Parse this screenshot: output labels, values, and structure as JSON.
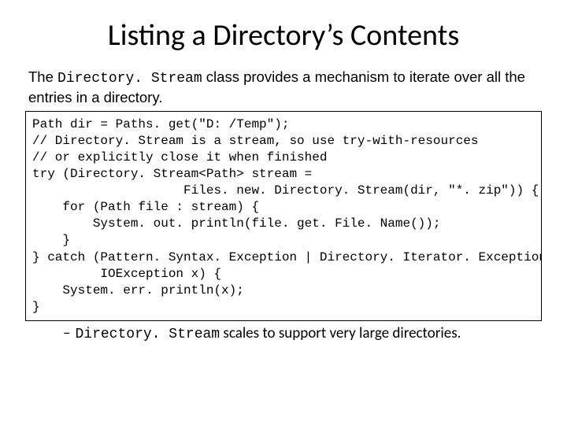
{
  "title": "Listing a Directory’s Contents",
  "intro": {
    "prefix": "The ",
    "class_name": "Directory. Stream",
    "suffix": " class provides a mechanism to iterate over all the entries in a directory."
  },
  "code": {
    "lines": [
      "Path dir = Paths. get(\"D: /Temp\");",
      "// Directory. Stream is a stream, so use try-with-resources",
      "// or explicitly close it when finished",
      "try (Directory. Stream<Path> stream =",
      "                    Files. new. Directory. Stream(dir, \"*. zip\")) {",
      "    for (Path file : stream) {",
      "        System. out. println(file. get. File. Name());",
      "    }",
      "} catch (Pattern. Syntax. Exception | Directory. Iterator. Exception |",
      "         IOException x) {",
      "    System. err. println(x);",
      "}"
    ]
  },
  "footnote": {
    "dash": "–",
    "class_name": "Directory. Stream",
    "text": " scales to support very large directories."
  }
}
